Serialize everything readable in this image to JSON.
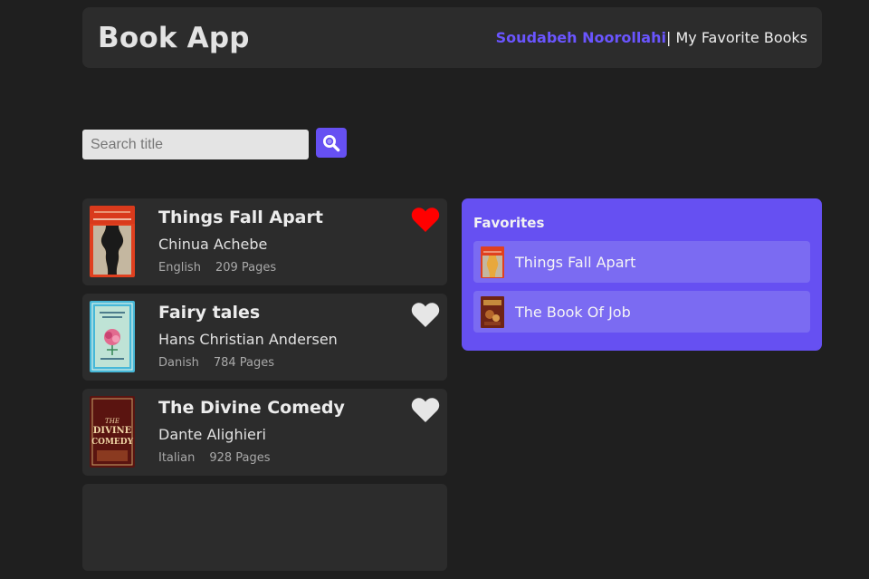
{
  "header": {
    "app_title": "Book App",
    "author": "Soudabeh Noorollahi",
    "separator": "|",
    "favorites_link": " My Favorite Books"
  },
  "search": {
    "placeholder": "Search title",
    "value": "",
    "button_icon": "search-icon"
  },
  "books": [
    {
      "title": "Things Fall Apart",
      "author": "Chinua Achebe",
      "language": "English",
      "pages": "209 Pages",
      "favorite": true,
      "cover_text": "Chinua Achebe THINGS FALL APART"
    },
    {
      "title": "Fairy tales",
      "author": "Hans Christian Andersen",
      "language": "Danish",
      "pages": "784 Pages",
      "favorite": false,
      "cover_text": ""
    },
    {
      "title": "The Divine Comedy",
      "author": "Dante Alighieri",
      "language": "Italian",
      "pages": "928 Pages",
      "favorite": false,
      "cover_text": "THE DIVINE COMEDY"
    }
  ],
  "favorites": {
    "heading": "Favorites",
    "items": [
      {
        "title": "Things Fall Apart"
      },
      {
        "title": "The Book Of Job"
      }
    ]
  },
  "colors": {
    "background": "#1f1f1f",
    "panel": "#2c2c2c",
    "accent": "#6650f2",
    "author_link": "#6a55ff",
    "heart_active": "#ff0000",
    "heart_inactive": "#e6e6e6"
  }
}
